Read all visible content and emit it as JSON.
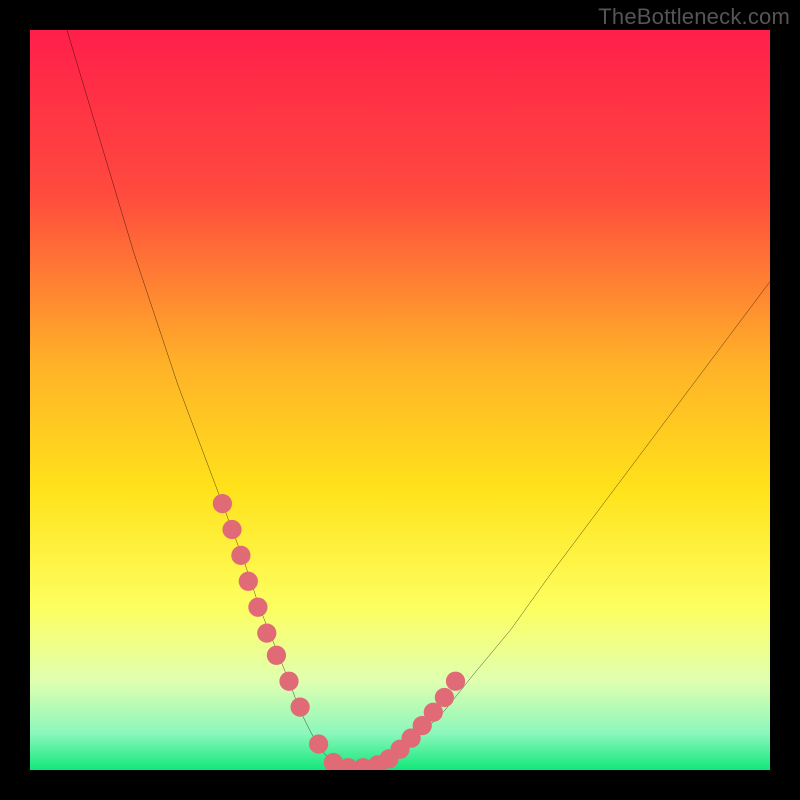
{
  "watermark": "TheBottleneck.com",
  "chart_data": {
    "type": "line",
    "title": "",
    "xlabel": "",
    "ylabel": "",
    "xlim": [
      0,
      100
    ],
    "ylim": [
      0,
      100
    ],
    "grid": false,
    "series": [
      {
        "name": "curve",
        "x": [
          5,
          8,
          11,
          14,
          17,
          20,
          23,
          26,
          29,
          31,
          33,
          35,
          36.5,
          38,
          39.5,
          41,
          43,
          45,
          48,
          52,
          56,
          60,
          65,
          70,
          76,
          82,
          88,
          94,
          100
        ],
        "y": [
          100,
          90,
          80,
          70,
          61,
          52,
          44,
          36,
          28,
          22,
          17,
          12,
          8,
          5,
          2.5,
          1,
          0.3,
          0.3,
          1.2,
          4,
          8,
          13,
          19,
          26,
          34,
          42,
          50,
          58,
          66
        ]
      }
    ],
    "points": {
      "name": "dots",
      "x": [
        26,
        27.3,
        28.5,
        29.5,
        30.8,
        32,
        33.3,
        35,
        36.5,
        39,
        41,
        43,
        45,
        47,
        48.5,
        50,
        51.5,
        53,
        54.5,
        56,
        57.5
      ],
      "y": [
        36,
        32.5,
        29,
        25.5,
        22,
        18.5,
        15.5,
        12,
        8.5,
        3.5,
        1.0,
        0.3,
        0.3,
        0.7,
        1.5,
        2.8,
        4.3,
        6.0,
        7.8,
        9.8,
        12.0
      ]
    },
    "gradient_stops": [
      {
        "offset": 0,
        "color": "#ff1f4a"
      },
      {
        "offset": 22,
        "color": "#ff4a3e"
      },
      {
        "offset": 45,
        "color": "#ffb128"
      },
      {
        "offset": 62,
        "color": "#ffe21a"
      },
      {
        "offset": 78,
        "color": "#fdff60"
      },
      {
        "offset": 88,
        "color": "#e0ffb0"
      },
      {
        "offset": 95,
        "color": "#8cf7bc"
      },
      {
        "offset": 100,
        "color": "#12e87a"
      }
    ],
    "dot_color": "#e06a76",
    "curve_color": "#000000"
  }
}
